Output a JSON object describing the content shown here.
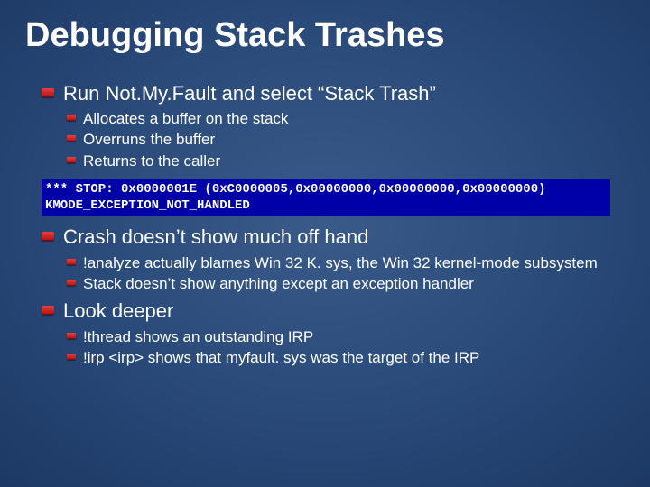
{
  "title": "Debugging Stack Trashes",
  "bullets": {
    "b1": "Run Not.My.Fault and select “Stack Trash”",
    "b1_1": "Allocates a buffer on the stack",
    "b1_2": "Overruns the buffer",
    "b1_3": "Returns to the caller",
    "stop_line1": "*** STOP: 0x0000001E (0xC0000005,0x00000000,0x00000000,0x00000000)",
    "stop_line2": "KMODE_EXCEPTION_NOT_HANDLED",
    "b2": "Crash doesn’t show much off hand",
    "b2_1": "!analyze actually blames Win 32 K. sys, the Win 32 kernel-mode subsystem",
    "b2_2": "Stack doesn’t show anything except an exception handler",
    "b3": "Look deeper",
    "b3_1": "!thread shows an outstanding IRP",
    "b3_2": "!irp <irp> shows that myfault. sys was the target of the IRP"
  }
}
